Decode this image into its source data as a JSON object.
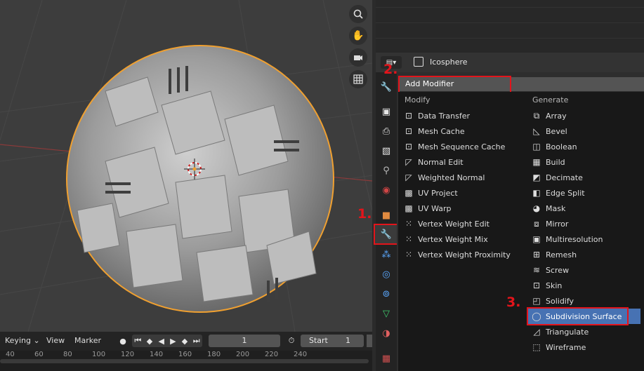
{
  "viewport": {
    "nav_icons": [
      "zoom-icon",
      "hand-pan-icon",
      "camera-icon",
      "grid-ortho-icon"
    ]
  },
  "properties": {
    "object_name": "Icosphere",
    "add_modifier_label": "Add Modifier",
    "columns": {
      "modify": {
        "title": "Modify",
        "items": [
          "Data Transfer",
          "Mesh Cache",
          "Mesh Sequence Cache",
          "Normal Edit",
          "Weighted Normal",
          "UV Project",
          "UV Warp",
          "Vertex Weight Edit",
          "Vertex Weight Mix",
          "Vertex Weight Proximity"
        ]
      },
      "generate": {
        "title": "Generate",
        "items": [
          "Array",
          "Bevel",
          "Boolean",
          "Build",
          "Decimate",
          "Edge Split",
          "Mask",
          "Mirror",
          "Multiresolution",
          "Remesh",
          "Screw",
          "Skin",
          "Solidify",
          "Subdivision Surface",
          "Triangulate",
          "Wireframe"
        ]
      }
    },
    "highlighted_item": "Subdivision Surface",
    "accent_color": "#4772b3"
  },
  "annotations": {
    "step1": "1.",
    "step2": "2.",
    "step3": "3."
  },
  "timeline": {
    "keying": "Keying",
    "view": "View",
    "marker": "Marker",
    "current_frame": "1",
    "start_label": "Start",
    "start_value": "1",
    "ruler_ticks": [
      "40",
      "60",
      "80",
      "100",
      "120",
      "140",
      "160",
      "180",
      "200",
      "220",
      "240"
    ]
  }
}
